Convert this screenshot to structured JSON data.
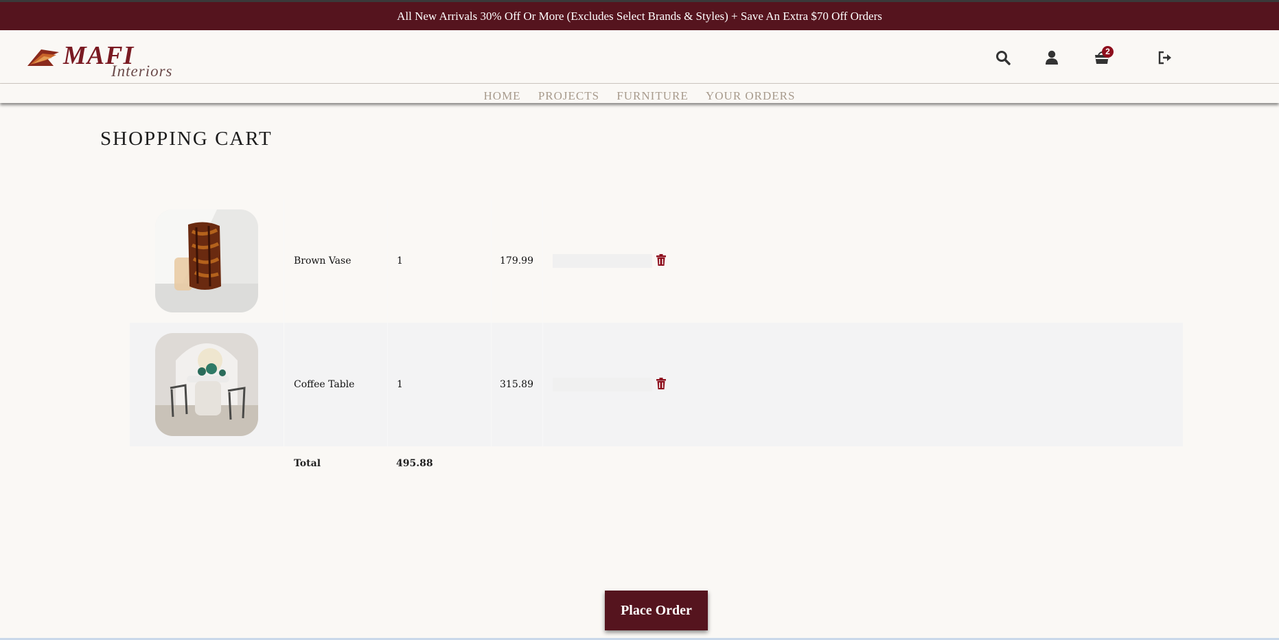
{
  "promo": {
    "text": "All New Arrivals 30% Off Or More (Excludes Select Brands & Styles) + Save An Extra $70 Off Orders"
  },
  "brand": {
    "name": "MAFI",
    "sub": "Interiors"
  },
  "header": {
    "icons": [
      "search-icon",
      "user-icon",
      "cart-icon",
      "logout-icon"
    ],
    "cart_count": "2"
  },
  "nav": {
    "items": [
      "HOME",
      "PROJECTS",
      "FURNITURE",
      "YOUR ORDERS"
    ]
  },
  "page": {
    "title": "SHOPPING CART"
  },
  "cart": {
    "items": [
      {
        "name": "Brown Vase",
        "qty": "1",
        "price": "179.99"
      },
      {
        "name": "Coffee Table",
        "qty": "1",
        "price": "315.89"
      }
    ],
    "total_label": "Total",
    "total_value": "495.88"
  },
  "actions": {
    "place_order": "Place Order"
  },
  "colors": {
    "brand": "#55141e",
    "accent": "#8e0f1d",
    "background": "#faf8f5",
    "nav_text": "#a79a8c"
  }
}
